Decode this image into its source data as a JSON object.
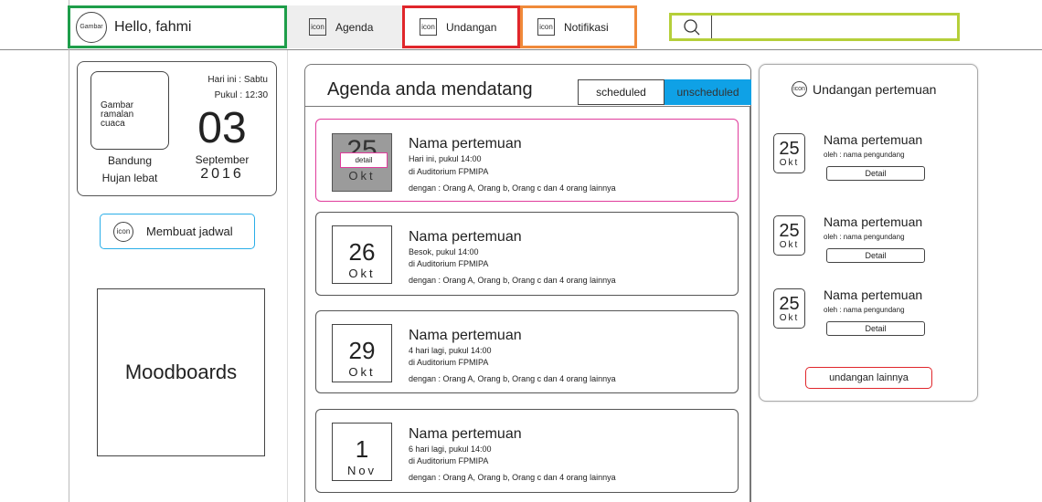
{
  "header": {
    "avatar_label": "Gambar",
    "greeting": "Hello, fahmi",
    "nav": [
      {
        "icon_label": "icon",
        "label": "Agenda"
      },
      {
        "icon_label": "icon",
        "label": "Undangan"
      },
      {
        "icon_label": "icon",
        "label": "Notifikasi"
      }
    ],
    "search_value": ""
  },
  "left": {
    "weather": {
      "image_label": "Gambar ramalan cuaca",
      "city": "Bandung",
      "condition": "Hujan lebat",
      "day": "Hari ini : Sabtu",
      "time": "Pukul : 12:30",
      "date": "03",
      "month": "September",
      "year": "2016"
    },
    "create_schedule": {
      "icon_label": "icon",
      "label": "Membuat jadwal"
    },
    "moodboards": "Moodboards"
  },
  "agenda": {
    "title": "Agenda anda mendatang",
    "tabs": [
      "scheduled",
      "unscheduled"
    ],
    "items": [
      {
        "day": "25",
        "month": "Okt",
        "name": "Nama pertemuan",
        "when": "Hari ini, pukul 14:00",
        "place": "di Auditorium FPMIPA",
        "with": "dengan : Orang A, Orang b, Orang c dan 4 orang lainnya",
        "detail_label": "detail"
      },
      {
        "day": "26",
        "month": "Okt",
        "name": "Nama pertemuan",
        "when": "Besok, pukul 14:00",
        "place": "di Auditorium FPMIPA",
        "with": "dengan : Orang A, Orang b, Orang c dan 4 orang lainnya"
      },
      {
        "day": "29",
        "month": "Okt",
        "name": "Nama pertemuan",
        "when": "4 hari lagi, pukul 14:00",
        "place": "di Auditorium FPMIPA",
        "with": "dengan : Orang A, Orang b, Orang c dan 4 orang lainnya"
      },
      {
        "day": "1",
        "month": "Nov",
        "name": "Nama pertemuan",
        "when": "6 hari lagi, pukul 14:00",
        "place": "di Auditorium FPMIPA",
        "with": "dengan : Orang A, Orang b, Orang c dan 4 orang lainnya"
      }
    ]
  },
  "invitations": {
    "icon_label": "icon",
    "title": "Undangan pertemuan",
    "items": [
      {
        "day": "25",
        "month": "Okt",
        "name": "Nama pertemuan",
        "by": "oleh : nama pengundang",
        "detail_label": "Detail"
      },
      {
        "day": "25",
        "month": "Okt",
        "name": "Nama pertemuan",
        "by": "oleh : nama pengundang",
        "detail_label": "Detail"
      },
      {
        "day": "25",
        "month": "Okt",
        "name": "Nama pertemuan",
        "by": "oleh : nama pengundang",
        "detail_label": "Detail"
      }
    ],
    "more_label": "undangan lainnya"
  },
  "colors": {
    "greeting_border": "#1e9e4a",
    "undangan_border": "#e0262b",
    "notifikasi_border": "#f08a3a",
    "search_border": "#b5cf3a",
    "tab_active": "#0fa1e6",
    "highlight": "#e03c9c",
    "create_border": "#2aaee8",
    "more_border": "#e0262b"
  }
}
